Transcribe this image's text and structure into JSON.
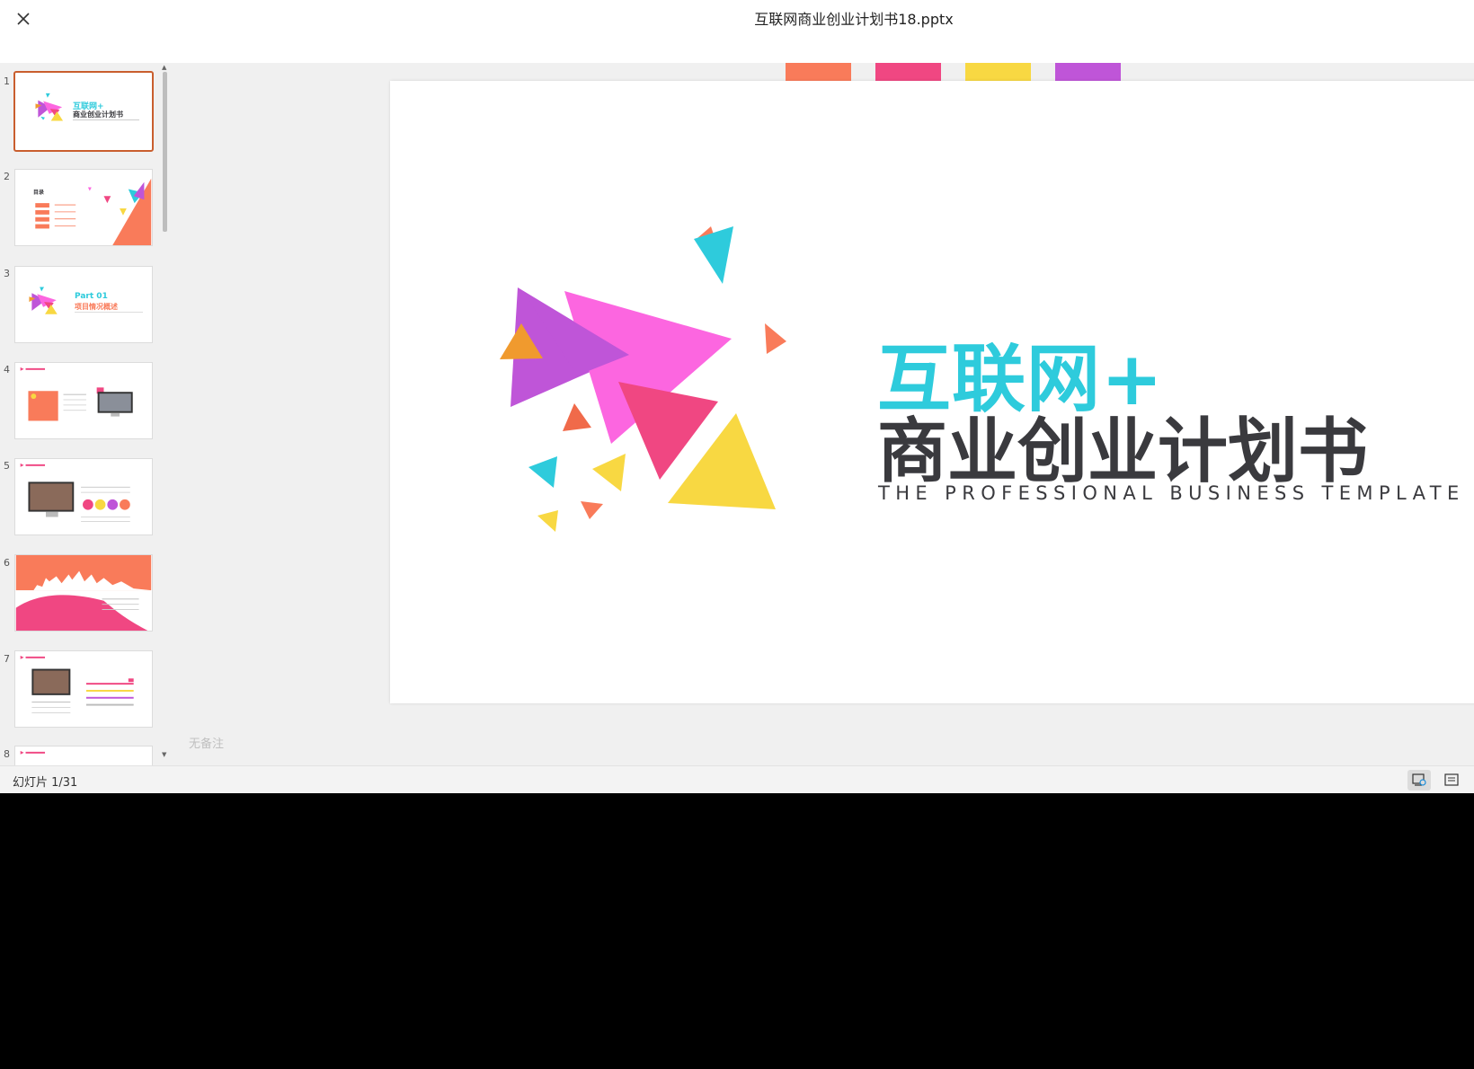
{
  "window": {
    "title": "互联网商业创业计划书18.pptx",
    "close_icon": "close-icon"
  },
  "sidebar": {
    "thumbnails": [
      {
        "number": "1",
        "active": true,
        "title": "互联网+",
        "subtitle": "商业创业计划书"
      },
      {
        "number": "2",
        "active": false,
        "title": "目录"
      },
      {
        "number": "3",
        "active": false,
        "title": "Part 01",
        "subtitle": "项目情况概述"
      },
      {
        "number": "4",
        "active": false
      },
      {
        "number": "5",
        "active": false
      },
      {
        "number": "6",
        "active": false
      },
      {
        "number": "7",
        "active": false
      },
      {
        "number": "8",
        "active": false
      }
    ]
  },
  "slide": {
    "title_line1": "互联网+",
    "title_line2": "商业创业计划书",
    "subtitle": "THE PROFESSIONAL BUSINESS TEMPLATE",
    "theme_colors": [
      "#f97b5a",
      "#f04782",
      "#f8d842",
      "#bf55d8"
    ]
  },
  "notes": {
    "placeholder": "无备注"
  },
  "statusbar": {
    "slide_counter": "幻灯片 1/31",
    "normal_view_icon": "slide-view-icon",
    "notes_view_icon": "notes-view-icon"
  },
  "colors": {
    "accent": "#c95e2e",
    "title_cyan": "#2ecbdc",
    "title_dark": "#3a3a3e"
  }
}
